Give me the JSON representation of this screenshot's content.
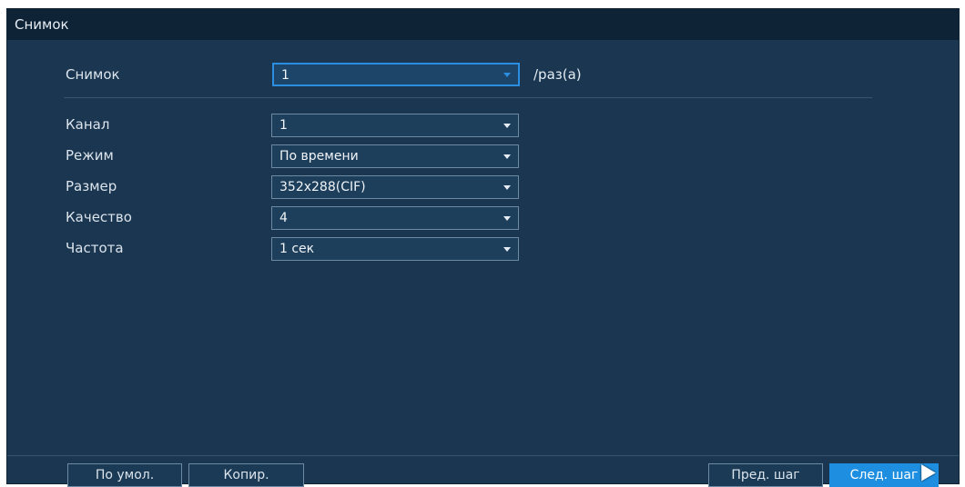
{
  "window": {
    "title": "Снимок"
  },
  "snapshot": {
    "label": "Снимок",
    "value": "1",
    "unit": "/раз(а)"
  },
  "fields": [
    {
      "label": "Канал",
      "value": "1"
    },
    {
      "label": "Режим",
      "value": "По времени"
    },
    {
      "label": "Размер",
      "value": "352x288(CIF)"
    },
    {
      "label": "Качество",
      "value": "4"
    },
    {
      "label": "Частота",
      "value": "1 сек"
    }
  ],
  "buttons": {
    "default": "По умол.",
    "copy": "Копир.",
    "prev": "Пред. шаг",
    "next": "След. шаг"
  },
  "colors": {
    "accent": "#1e8fe0",
    "panel": "#1a3650",
    "titlebar": "#0f2337"
  }
}
